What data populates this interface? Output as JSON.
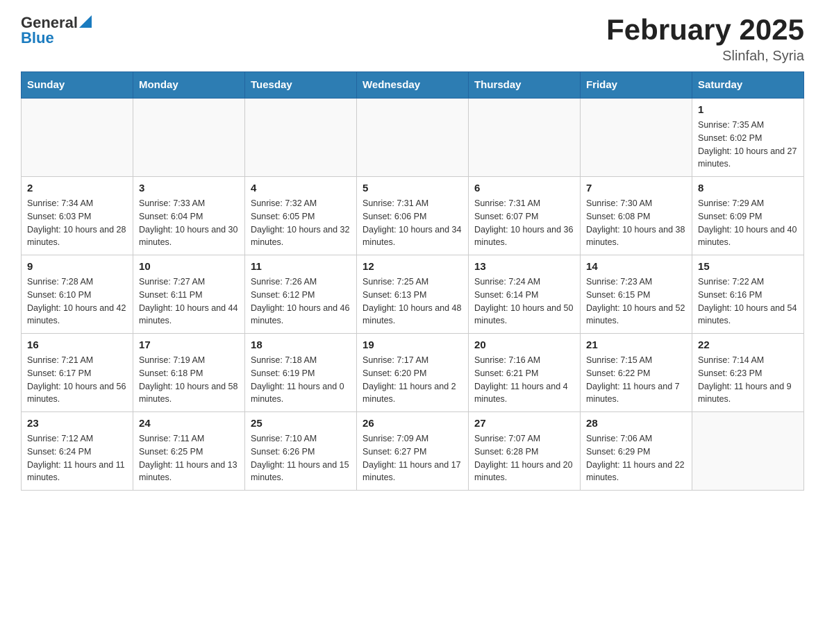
{
  "header": {
    "logo_general": "General",
    "logo_blue": "Blue",
    "title": "February 2025",
    "subtitle": "Slinfah, Syria"
  },
  "calendar": {
    "days_of_week": [
      "Sunday",
      "Monday",
      "Tuesday",
      "Wednesday",
      "Thursday",
      "Friday",
      "Saturday"
    ],
    "weeks": [
      [
        {
          "day": "",
          "sunrise": "",
          "sunset": "",
          "daylight": "",
          "empty": true
        },
        {
          "day": "",
          "sunrise": "",
          "sunset": "",
          "daylight": "",
          "empty": true
        },
        {
          "day": "",
          "sunrise": "",
          "sunset": "",
          "daylight": "",
          "empty": true
        },
        {
          "day": "",
          "sunrise": "",
          "sunset": "",
          "daylight": "",
          "empty": true
        },
        {
          "day": "",
          "sunrise": "",
          "sunset": "",
          "daylight": "",
          "empty": true
        },
        {
          "day": "",
          "sunrise": "",
          "sunset": "",
          "daylight": "",
          "empty": true
        },
        {
          "day": "1",
          "sunrise": "Sunrise: 7:35 AM",
          "sunset": "Sunset: 6:02 PM",
          "daylight": "Daylight: 10 hours and 27 minutes.",
          "empty": false
        }
      ],
      [
        {
          "day": "2",
          "sunrise": "Sunrise: 7:34 AM",
          "sunset": "Sunset: 6:03 PM",
          "daylight": "Daylight: 10 hours and 28 minutes.",
          "empty": false
        },
        {
          "day": "3",
          "sunrise": "Sunrise: 7:33 AM",
          "sunset": "Sunset: 6:04 PM",
          "daylight": "Daylight: 10 hours and 30 minutes.",
          "empty": false
        },
        {
          "day": "4",
          "sunrise": "Sunrise: 7:32 AM",
          "sunset": "Sunset: 6:05 PM",
          "daylight": "Daylight: 10 hours and 32 minutes.",
          "empty": false
        },
        {
          "day": "5",
          "sunrise": "Sunrise: 7:31 AM",
          "sunset": "Sunset: 6:06 PM",
          "daylight": "Daylight: 10 hours and 34 minutes.",
          "empty": false
        },
        {
          "day": "6",
          "sunrise": "Sunrise: 7:31 AM",
          "sunset": "Sunset: 6:07 PM",
          "daylight": "Daylight: 10 hours and 36 minutes.",
          "empty": false
        },
        {
          "day": "7",
          "sunrise": "Sunrise: 7:30 AM",
          "sunset": "Sunset: 6:08 PM",
          "daylight": "Daylight: 10 hours and 38 minutes.",
          "empty": false
        },
        {
          "day": "8",
          "sunrise": "Sunrise: 7:29 AM",
          "sunset": "Sunset: 6:09 PM",
          "daylight": "Daylight: 10 hours and 40 minutes.",
          "empty": false
        }
      ],
      [
        {
          "day": "9",
          "sunrise": "Sunrise: 7:28 AM",
          "sunset": "Sunset: 6:10 PM",
          "daylight": "Daylight: 10 hours and 42 minutes.",
          "empty": false
        },
        {
          "day": "10",
          "sunrise": "Sunrise: 7:27 AM",
          "sunset": "Sunset: 6:11 PM",
          "daylight": "Daylight: 10 hours and 44 minutes.",
          "empty": false
        },
        {
          "day": "11",
          "sunrise": "Sunrise: 7:26 AM",
          "sunset": "Sunset: 6:12 PM",
          "daylight": "Daylight: 10 hours and 46 minutes.",
          "empty": false
        },
        {
          "day": "12",
          "sunrise": "Sunrise: 7:25 AM",
          "sunset": "Sunset: 6:13 PM",
          "daylight": "Daylight: 10 hours and 48 minutes.",
          "empty": false
        },
        {
          "day": "13",
          "sunrise": "Sunrise: 7:24 AM",
          "sunset": "Sunset: 6:14 PM",
          "daylight": "Daylight: 10 hours and 50 minutes.",
          "empty": false
        },
        {
          "day": "14",
          "sunrise": "Sunrise: 7:23 AM",
          "sunset": "Sunset: 6:15 PM",
          "daylight": "Daylight: 10 hours and 52 minutes.",
          "empty": false
        },
        {
          "day": "15",
          "sunrise": "Sunrise: 7:22 AM",
          "sunset": "Sunset: 6:16 PM",
          "daylight": "Daylight: 10 hours and 54 minutes.",
          "empty": false
        }
      ],
      [
        {
          "day": "16",
          "sunrise": "Sunrise: 7:21 AM",
          "sunset": "Sunset: 6:17 PM",
          "daylight": "Daylight: 10 hours and 56 minutes.",
          "empty": false
        },
        {
          "day": "17",
          "sunrise": "Sunrise: 7:19 AM",
          "sunset": "Sunset: 6:18 PM",
          "daylight": "Daylight: 10 hours and 58 minutes.",
          "empty": false
        },
        {
          "day": "18",
          "sunrise": "Sunrise: 7:18 AM",
          "sunset": "Sunset: 6:19 PM",
          "daylight": "Daylight: 11 hours and 0 minutes.",
          "empty": false
        },
        {
          "day": "19",
          "sunrise": "Sunrise: 7:17 AM",
          "sunset": "Sunset: 6:20 PM",
          "daylight": "Daylight: 11 hours and 2 minutes.",
          "empty": false
        },
        {
          "day": "20",
          "sunrise": "Sunrise: 7:16 AM",
          "sunset": "Sunset: 6:21 PM",
          "daylight": "Daylight: 11 hours and 4 minutes.",
          "empty": false
        },
        {
          "day": "21",
          "sunrise": "Sunrise: 7:15 AM",
          "sunset": "Sunset: 6:22 PM",
          "daylight": "Daylight: 11 hours and 7 minutes.",
          "empty": false
        },
        {
          "day": "22",
          "sunrise": "Sunrise: 7:14 AM",
          "sunset": "Sunset: 6:23 PM",
          "daylight": "Daylight: 11 hours and 9 minutes.",
          "empty": false
        }
      ],
      [
        {
          "day": "23",
          "sunrise": "Sunrise: 7:12 AM",
          "sunset": "Sunset: 6:24 PM",
          "daylight": "Daylight: 11 hours and 11 minutes.",
          "empty": false
        },
        {
          "day": "24",
          "sunrise": "Sunrise: 7:11 AM",
          "sunset": "Sunset: 6:25 PM",
          "daylight": "Daylight: 11 hours and 13 minutes.",
          "empty": false
        },
        {
          "day": "25",
          "sunrise": "Sunrise: 7:10 AM",
          "sunset": "Sunset: 6:26 PM",
          "daylight": "Daylight: 11 hours and 15 minutes.",
          "empty": false
        },
        {
          "day": "26",
          "sunrise": "Sunrise: 7:09 AM",
          "sunset": "Sunset: 6:27 PM",
          "daylight": "Daylight: 11 hours and 17 minutes.",
          "empty": false
        },
        {
          "day": "27",
          "sunrise": "Sunrise: 7:07 AM",
          "sunset": "Sunset: 6:28 PM",
          "daylight": "Daylight: 11 hours and 20 minutes.",
          "empty": false
        },
        {
          "day": "28",
          "sunrise": "Sunrise: 7:06 AM",
          "sunset": "Sunset: 6:29 PM",
          "daylight": "Daylight: 11 hours and 22 minutes.",
          "empty": false
        },
        {
          "day": "",
          "sunrise": "",
          "sunset": "",
          "daylight": "",
          "empty": true
        }
      ]
    ]
  }
}
